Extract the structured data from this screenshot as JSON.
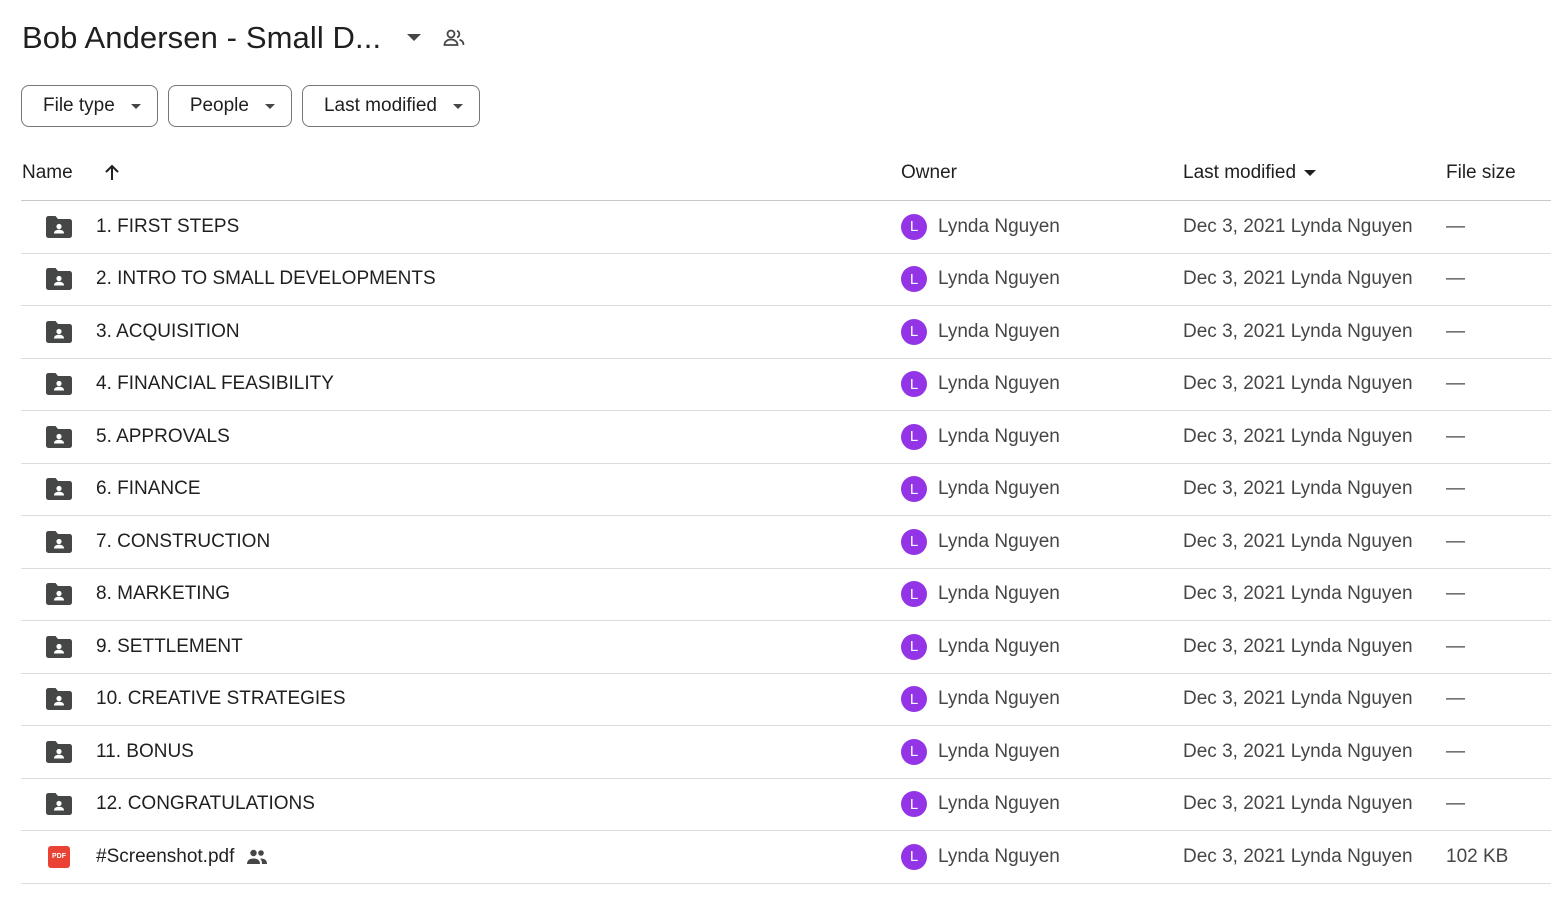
{
  "header": {
    "title": "Bob Andersen - Small D...",
    "caret_icon": "arrow-drop-down-icon",
    "share_icon": "people-icon"
  },
  "filters": [
    {
      "label": "File type"
    },
    {
      "label": "People"
    },
    {
      "label": "Last modified"
    }
  ],
  "columns": {
    "name": "Name",
    "owner": "Owner",
    "modified": "Last modified",
    "size": "File size"
  },
  "colors": {
    "avatar": "#9334e6",
    "pdf": "#ea4335",
    "folder": "#444746"
  },
  "rows": [
    {
      "name": "1. FIRST STEPS",
      "type": "shared-folder",
      "owner_initial": "L",
      "owner": "Lynda Nguyen",
      "modified": "Dec 3, 2021 Lynda Nguyen",
      "size": "—"
    },
    {
      "name": "2. INTRO TO SMALL DEVELOPMENTS",
      "type": "shared-folder",
      "owner_initial": "L",
      "owner": "Lynda Nguyen",
      "modified": "Dec 3, 2021 Lynda Nguyen",
      "size": "—"
    },
    {
      "name": "3. ACQUISITION",
      "type": "shared-folder",
      "owner_initial": "L",
      "owner": "Lynda Nguyen",
      "modified": "Dec 3, 2021 Lynda Nguyen",
      "size": "—"
    },
    {
      "name": "4. FINANCIAL FEASIBILITY",
      "type": "shared-folder",
      "owner_initial": "L",
      "owner": "Lynda Nguyen",
      "modified": "Dec 3, 2021 Lynda Nguyen",
      "size": "—"
    },
    {
      "name": "5. APPROVALS",
      "type": "shared-folder",
      "owner_initial": "L",
      "owner": "Lynda Nguyen",
      "modified": "Dec 3, 2021 Lynda Nguyen",
      "size": "—"
    },
    {
      "name": "6. FINANCE",
      "type": "shared-folder",
      "owner_initial": "L",
      "owner": "Lynda Nguyen",
      "modified": "Dec 3, 2021 Lynda Nguyen",
      "size": "—"
    },
    {
      "name": "7. CONSTRUCTION",
      "type": "shared-folder",
      "owner_initial": "L",
      "owner": "Lynda Nguyen",
      "modified": "Dec 3, 2021 Lynda Nguyen",
      "size": "—"
    },
    {
      "name": "8. MARKETING",
      "type": "shared-folder",
      "owner_initial": "L",
      "owner": "Lynda Nguyen",
      "modified": "Dec 3, 2021 Lynda Nguyen",
      "size": "—"
    },
    {
      "name": "9. SETTLEMENT",
      "type": "shared-folder",
      "owner_initial": "L",
      "owner": "Lynda Nguyen",
      "modified": "Dec 3, 2021 Lynda Nguyen",
      "size": "—"
    },
    {
      "name": "10. CREATIVE STRATEGIES",
      "type": "shared-folder",
      "owner_initial": "L",
      "owner": "Lynda Nguyen",
      "modified": "Dec 3, 2021 Lynda Nguyen",
      "size": "—"
    },
    {
      "name": "11. BONUS",
      "type": "shared-folder",
      "owner_initial": "L",
      "owner": "Lynda Nguyen",
      "modified": "Dec 3, 2021 Lynda Nguyen",
      "size": "—"
    },
    {
      "name": "12. CONGRATULATIONS",
      "type": "shared-folder",
      "owner_initial": "L",
      "owner": "Lynda Nguyen",
      "modified": "Dec 3, 2021 Lynda Nguyen",
      "size": "—"
    },
    {
      "name": "#Screenshot.pdf",
      "type": "pdf",
      "icon_text": "PDF",
      "shared": true,
      "owner_initial": "L",
      "owner": "Lynda Nguyen",
      "modified": "Dec 3, 2021 Lynda Nguyen",
      "size": "102 KB"
    }
  ]
}
